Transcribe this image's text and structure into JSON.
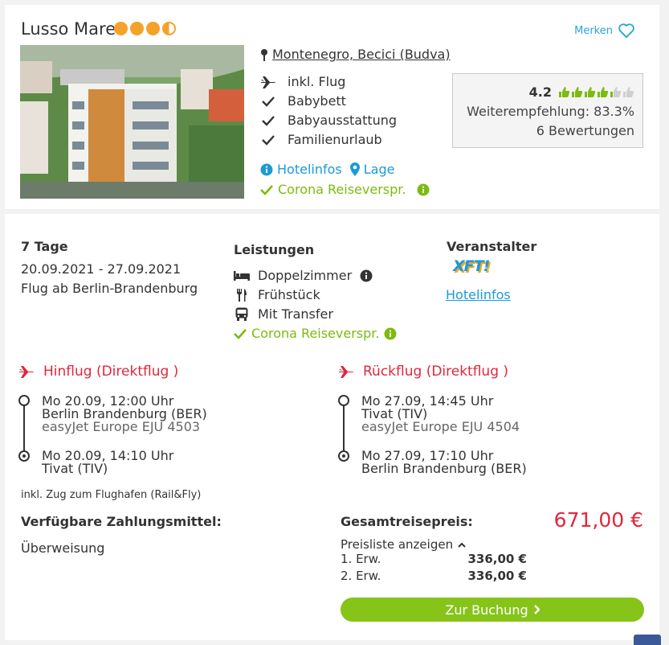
{
  "hotel": {
    "name": "Lusso Mare",
    "stars": 3.5,
    "merken_label": "Merken",
    "location": "Montenegro, Becici (Budva)",
    "features": [
      "inkl. Flug",
      "Babybett",
      "Babyausstattung",
      "Familienurlaub"
    ],
    "link_hotelinfos": "Hotelinfos",
    "link_lage": "Lage",
    "corona": "Corona Reiseverspr.",
    "rating": {
      "score": "4.2",
      "score_value": 4.2,
      "recommendation": "Weiterempfehlung: 83.3%",
      "reviews": "6 Bewertungen"
    }
  },
  "offer": {
    "duration": "7 Tage",
    "dates": "20.09.2021 - 27.09.2021",
    "departure": "Flug ab Berlin-Brandenburg",
    "services_title": "Leistungen",
    "services": [
      "Doppelzimmer",
      "Frühstück",
      "Mit Transfer"
    ],
    "services_corona": "Corona Reiseverspr.",
    "operator_title": "Veranstalter",
    "operator_logo": "XFT!",
    "operator_link": "Hotelinfos"
  },
  "outbound": {
    "title": "Hinflug (Direktflug )",
    "dep_time": "Mo 20.09, 12:00 Uhr",
    "dep_airport": "Berlin Brandenburg (BER)",
    "airline": "easyJet Europe EJU 4503",
    "arr_time": "Mo 20.09, 14:10 Uhr",
    "arr_airport": "Tivat (TIV)"
  },
  "return": {
    "title": "Rückflug (Direktflug )",
    "dep_time": "Mo 27.09, 14:45 Uhr",
    "dep_airport": "Tivat (TIV)",
    "airline": "easyJet Europe EJU 4504",
    "arr_time": "Mo 27.09, 17:10 Uhr",
    "arr_airport": "Berlin Brandenburg (BER)"
  },
  "rail": "inkl. Zug zum Flughafen (Rail&Fly)",
  "payment": {
    "title": "Verfügbare Zahlungsmittel:",
    "method": "Überweisung"
  },
  "pricing": {
    "total_label": "Gesamtreisepreis:",
    "total": "671,00 €",
    "toggle": "Preisliste anzeigen",
    "rows": [
      {
        "label": "1. Erw.",
        "price": "336,00 €"
      },
      {
        "label": "2. Erw.",
        "price": "336,00 €"
      }
    ],
    "button": "Zur Buchung"
  },
  "colors": {
    "accent_red": "#e2263a",
    "green": "#86c41a",
    "link_blue": "#1a9bd7",
    "star_orange": "#f4a22a"
  }
}
